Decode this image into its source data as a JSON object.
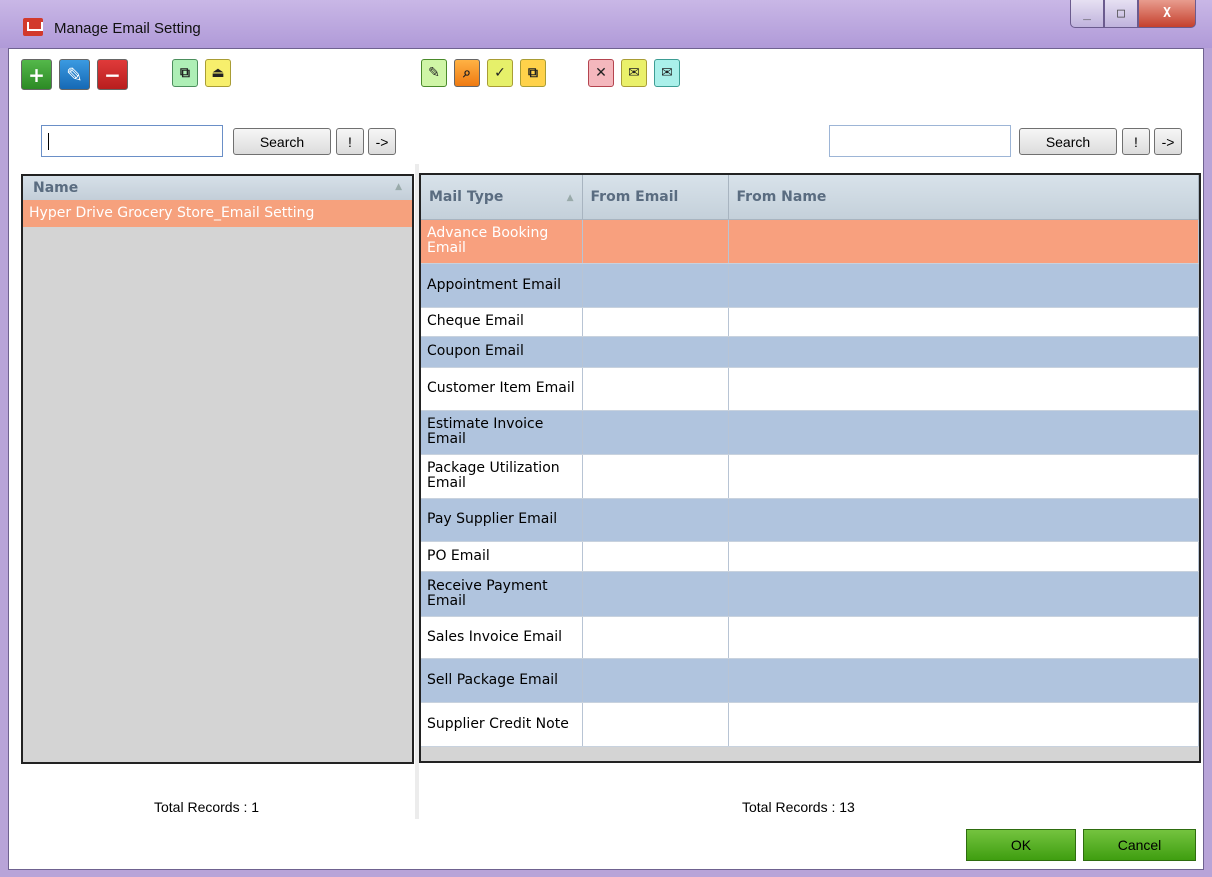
{
  "window": {
    "title": "Manage Email Setting",
    "min": "_",
    "max": "□",
    "close": "X"
  },
  "left": {
    "search_button": "Search",
    "bang_button": "!",
    "arrow_button": "->",
    "column": "Name",
    "rows": [
      "Hyper Drive Grocery Store_Email Setting"
    ],
    "total": "Total Records : 1"
  },
  "right": {
    "search_button": "Search",
    "bang_button": "!",
    "arrow_button": "->",
    "columns": [
      "Mail Type",
      "From Email",
      "From Name"
    ],
    "rows": [
      "Advance Booking Email",
      "Appointment Email",
      "Cheque Email",
      "Coupon Email",
      "Customer Item Email",
      "Estimate Invoice Email",
      "Package Utilization Email",
      "Pay Supplier Email",
      "PO Email",
      "Receive Payment Email",
      "Sales Invoice Email",
      "Sell Package Email",
      "Supplier Credit Note"
    ],
    "total": "Total Records : 13"
  },
  "footer": {
    "ok": "OK",
    "cancel": "Cancel"
  },
  "icons": {
    "left_toolbar": [
      "add-icon",
      "edit-icon",
      "delete-icon",
      "copy-icon",
      "export-icon"
    ],
    "right_toolbar": [
      "edit-icon",
      "preview-icon",
      "copy-check-icon",
      "copy-icon",
      "close-icon",
      "mail-send-icon",
      "mail-icon"
    ]
  },
  "colors": {
    "selected_row": "#f8a07e",
    "alt_row": "#b0c4de",
    "ok_button": "#4fa81a"
  }
}
